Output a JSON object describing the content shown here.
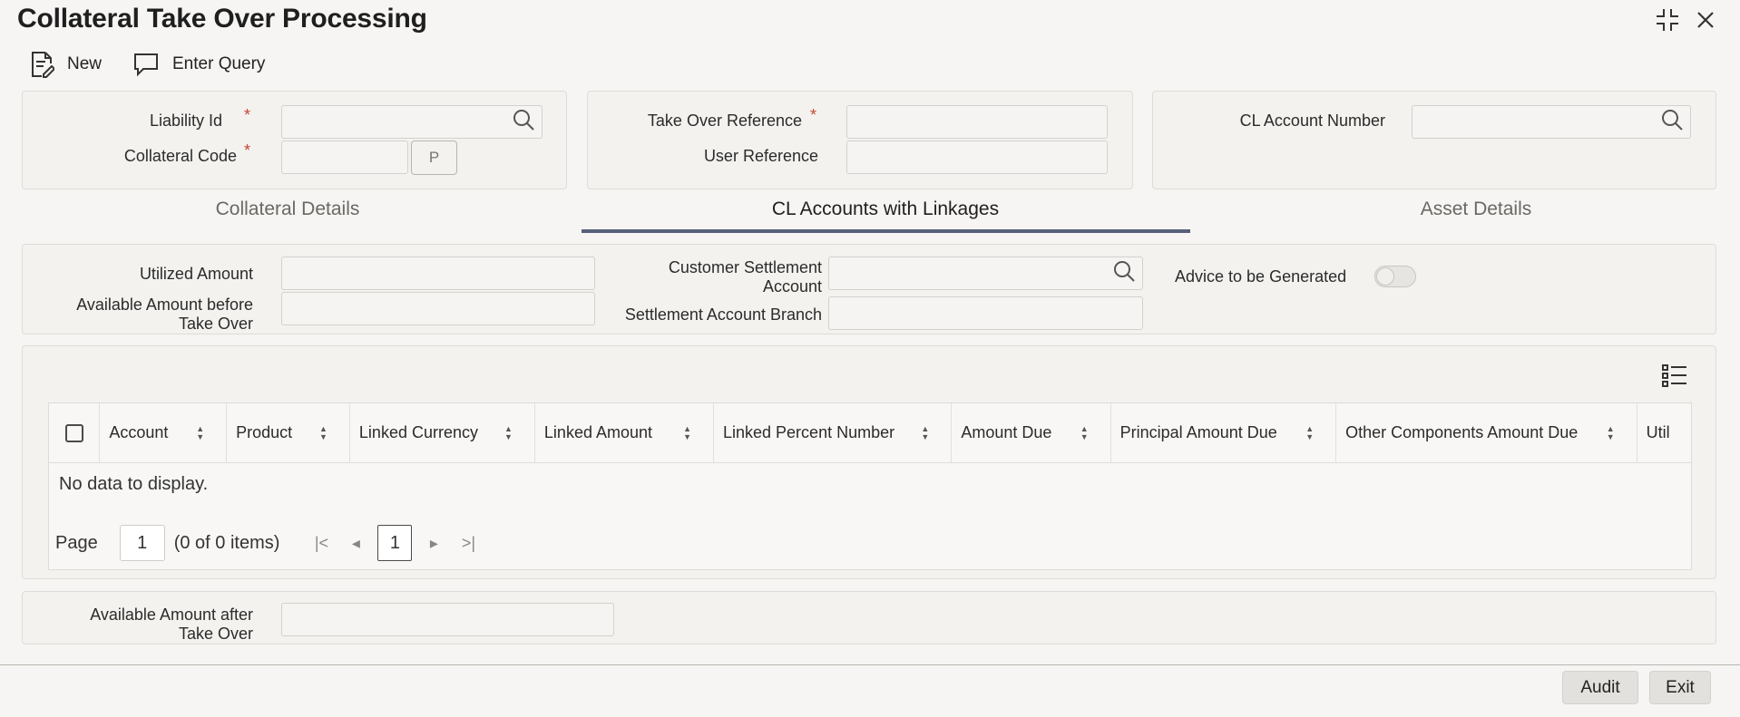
{
  "window": {
    "title": "Collateral Take Over Processing",
    "controls": [
      "minimize-icon",
      "close-icon"
    ]
  },
  "toolbar": {
    "new_label": "New",
    "enter_query_label": "Enter Query"
  },
  "header_form": {
    "liability_id": {
      "label": "Liability Id",
      "value": ""
    },
    "collateral_code": {
      "label": "Collateral Code",
      "value": "",
      "pick_label": "P"
    },
    "take_over_reference": {
      "label": "Take Over Reference",
      "value": ""
    },
    "user_reference": {
      "label": "User Reference",
      "value": ""
    },
    "cl_account_number": {
      "label": "CL Account Number",
      "value": ""
    },
    "required_mark": "*"
  },
  "tabs": [
    {
      "label": "Collateral Details",
      "active": false
    },
    {
      "label": "CL Accounts with Linkages",
      "active": true
    },
    {
      "label": "Asset Details",
      "active": false
    }
  ],
  "linkage_form": {
    "utilized_amount": {
      "label": "Utilized Amount",
      "value": ""
    },
    "available_before": {
      "label_line1": "Available Amount before",
      "label_line2": "Take Over",
      "value": ""
    },
    "customer_settlement_account": {
      "label_line1": "Customer Settlement",
      "label_line2": "Account",
      "value": ""
    },
    "settlement_account_branch": {
      "label": "Settlement Account Branch",
      "value": ""
    },
    "advice_to_be_generated": {
      "label": "Advice to be Generated",
      "checked": false
    }
  },
  "grid": {
    "columns": [
      "Account",
      "Product",
      "Linked Currency",
      "Linked Amount",
      "Linked Percent Number",
      "Amount Due",
      "Principal Amount Due",
      "Other Components Amount Due",
      "Util"
    ],
    "empty_text": "No data to display.",
    "pagination": {
      "page_label": "Page",
      "page_value": "1",
      "items_text": "(0 of 0 items)",
      "current_page": "1"
    }
  },
  "after_form": {
    "available_after": {
      "label_line1": "Available Amount after",
      "label_line2": "Take Over",
      "value": ""
    }
  },
  "footer": {
    "audit_label": "Audit",
    "exit_label": "Exit"
  }
}
